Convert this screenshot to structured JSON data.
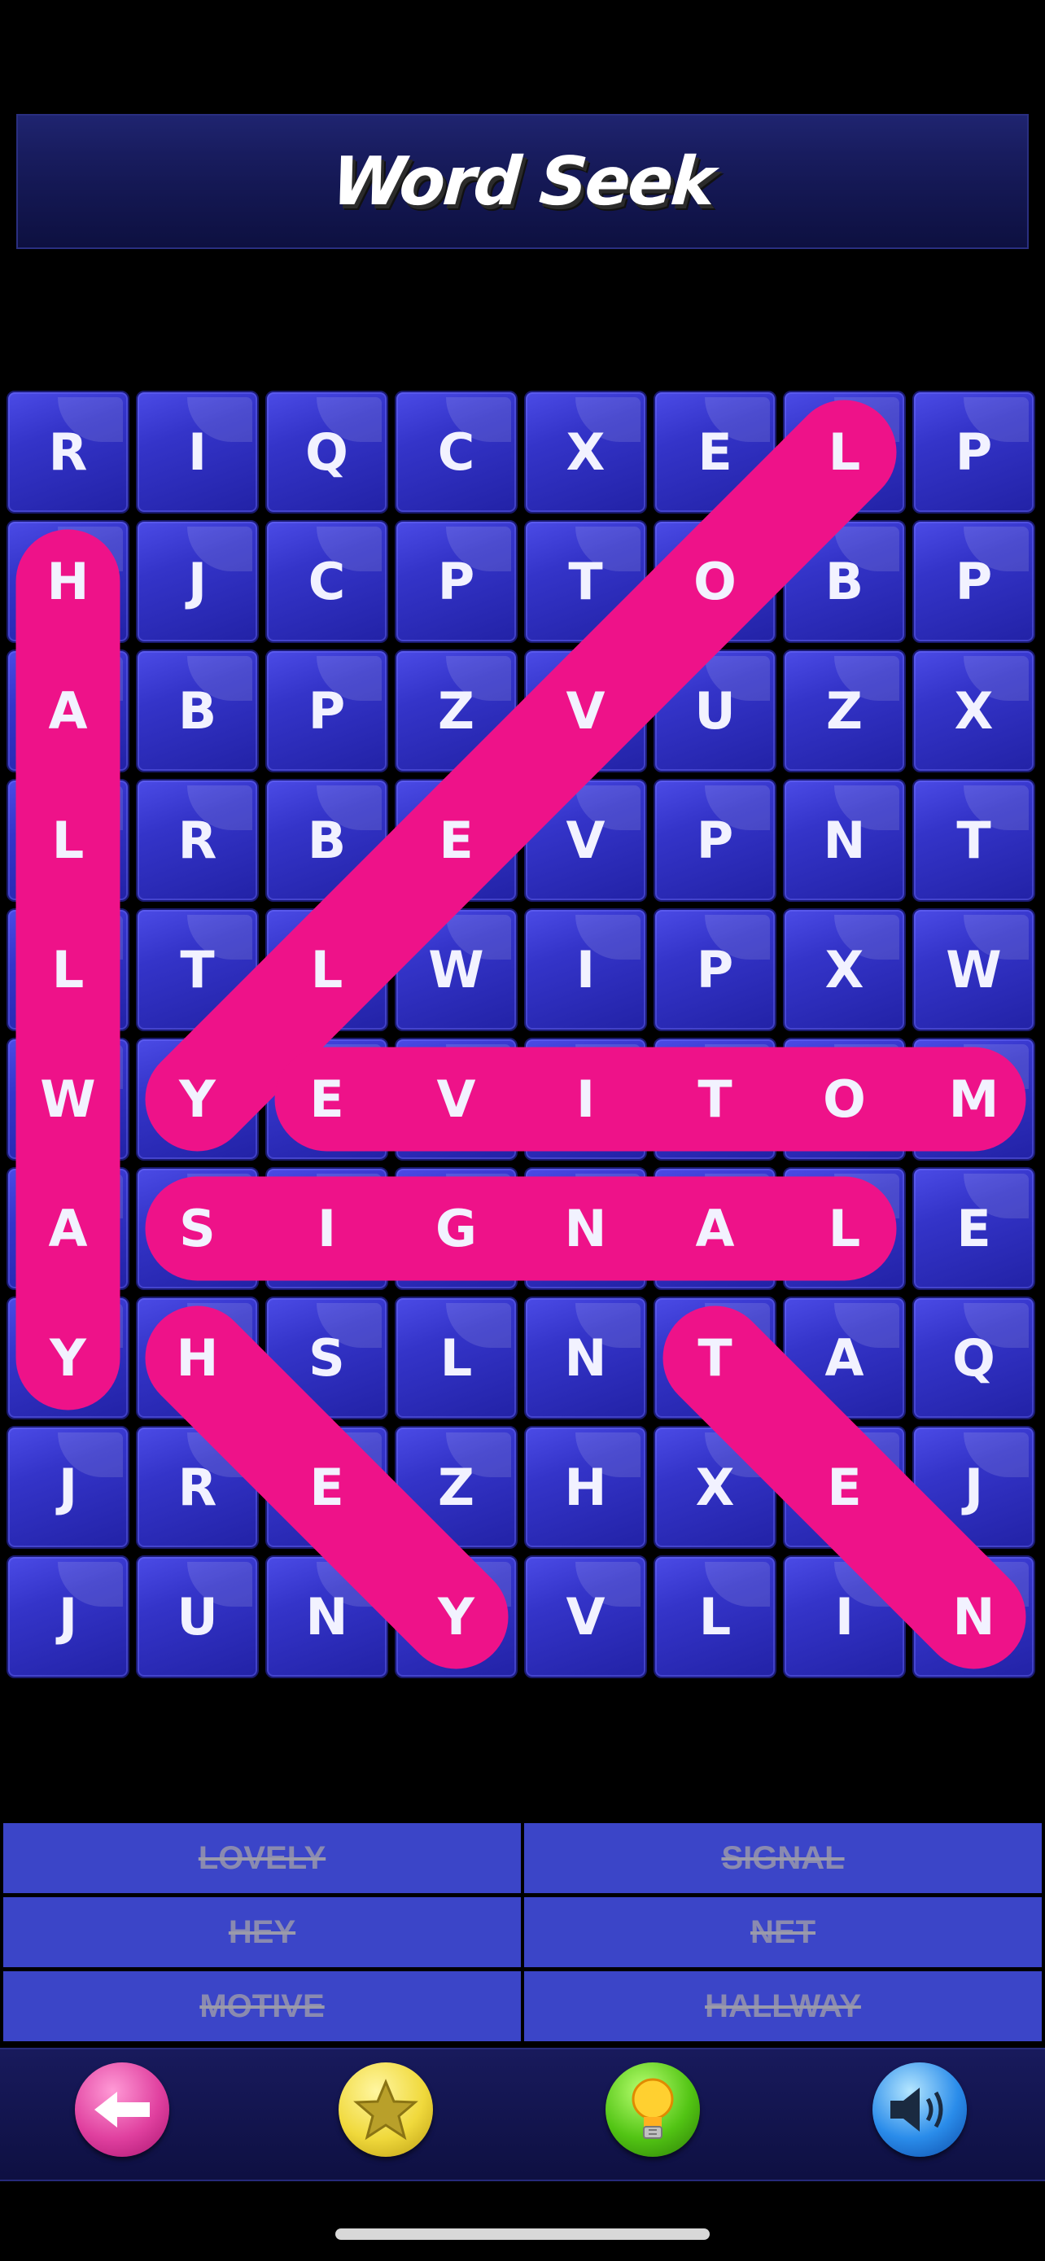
{
  "title": "Word Seek",
  "grid": [
    [
      "R",
      "I",
      "Q",
      "C",
      "X",
      "E",
      "L",
      "P"
    ],
    [
      "H",
      "J",
      "C",
      "P",
      "T",
      "O",
      "B",
      "P"
    ],
    [
      "A",
      "B",
      "P",
      "Z",
      "V",
      "U",
      "Z",
      "X"
    ],
    [
      "L",
      "R",
      "B",
      "E",
      "V",
      "P",
      "N",
      "T"
    ],
    [
      "L",
      "T",
      "L",
      "W",
      "I",
      "P",
      "X",
      "W"
    ],
    [
      "W",
      "Y",
      "E",
      "V",
      "I",
      "T",
      "O",
      "M"
    ],
    [
      "A",
      "S",
      "I",
      "G",
      "N",
      "A",
      "L",
      "E"
    ],
    [
      "Y",
      "H",
      "S",
      "L",
      "N",
      "T",
      "A",
      "Q"
    ],
    [
      "J",
      "R",
      "E",
      "Z",
      "H",
      "X",
      "E",
      "J"
    ],
    [
      "J",
      "U",
      "N",
      "Y",
      "V",
      "L",
      "I",
      "N"
    ]
  ],
  "found_words": [
    {
      "word": "LOVELY",
      "from": [
        0,
        6
      ],
      "to": [
        5,
        1
      ]
    },
    {
      "word": "SIGNAL",
      "from": [
        6,
        1
      ],
      "to": [
        6,
        6
      ]
    },
    {
      "word": "HEY",
      "from": [
        7,
        1
      ],
      "to": [
        9,
        3
      ]
    },
    {
      "word": "NET",
      "from": [
        9,
        7
      ],
      "to": [
        7,
        5
      ]
    },
    {
      "word": "MOTIVE",
      "from": [
        5,
        7
      ],
      "to": [
        5,
        2
      ]
    },
    {
      "word": "HALLWAY",
      "from": [
        1,
        0
      ],
      "to": [
        7,
        0
      ]
    }
  ],
  "word_list": {
    "left": [
      "LOVELY",
      "HEY",
      "MOTIVE"
    ],
    "right": [
      "SIGNAL",
      "NET",
      "HALLWAY"
    ]
  },
  "toolbar": {
    "back": "back-arrow-icon",
    "favorite": "star-icon",
    "hint": "lightbulb-icon",
    "sound": "speaker-icon"
  },
  "colors": {
    "highlight": "#ee1289",
    "tile": "#3434c9",
    "word_bg": "#3b45c8"
  }
}
